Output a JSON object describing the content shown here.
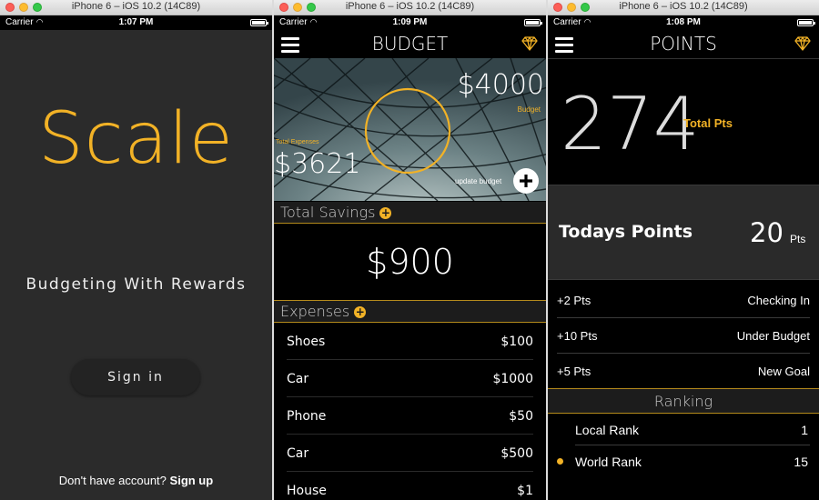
{
  "window_title": "iPhone 6 – iOS 10.2 (14C89)",
  "carrier": "Carrier",
  "screens": {
    "login": {
      "time": "1:07 PM",
      "logo": "Scale",
      "tagline": "Budgeting With Rewards",
      "sign_in": "Sign in",
      "no_account": "Don't have account?",
      "sign_up": "Sign up"
    },
    "budget": {
      "time": "1:09 PM",
      "title": "BUDGET",
      "budget_amount": "$4000",
      "budget_label": "Budget",
      "total_expenses_label": "Total Expenses",
      "total_expenses_amount": "$3621",
      "update_budget": "update budget",
      "savings_label": "Total Savings",
      "savings_amount": "$900",
      "expenses_label": "Expenses",
      "expenses": [
        {
          "name": "Shoes",
          "amount": "$100"
        },
        {
          "name": "Car",
          "amount": "$1000"
        },
        {
          "name": "Phone",
          "amount": "$50"
        },
        {
          "name": "Car",
          "amount": "$500"
        },
        {
          "name": "House",
          "amount": "$1"
        }
      ]
    },
    "points": {
      "time": "1:08 PM",
      "title": "POINTS",
      "total_points": "274",
      "total_label": "Total Pts",
      "today_label": "Todays Points",
      "today_value": "20",
      "today_unit": "Pts",
      "rewards": [
        {
          "pts": "+2 Pts",
          "desc": "Checking In"
        },
        {
          "pts": "+10 Pts",
          "desc": "Under Budget"
        },
        {
          "pts": "+5 Pts",
          "desc": "New Goal"
        }
      ],
      "ranking_label": "Ranking",
      "ranks": [
        {
          "name": "Local Rank",
          "value": "1"
        },
        {
          "name": "World Rank",
          "value": "15"
        }
      ]
    }
  },
  "colors": {
    "accent": "#f2b226",
    "background": "#000000",
    "login_bg": "#2b2b2b"
  },
  "icons": [
    "menu-icon",
    "diamond-icon",
    "plus-icon",
    "wifi-icon",
    "battery-icon"
  ]
}
